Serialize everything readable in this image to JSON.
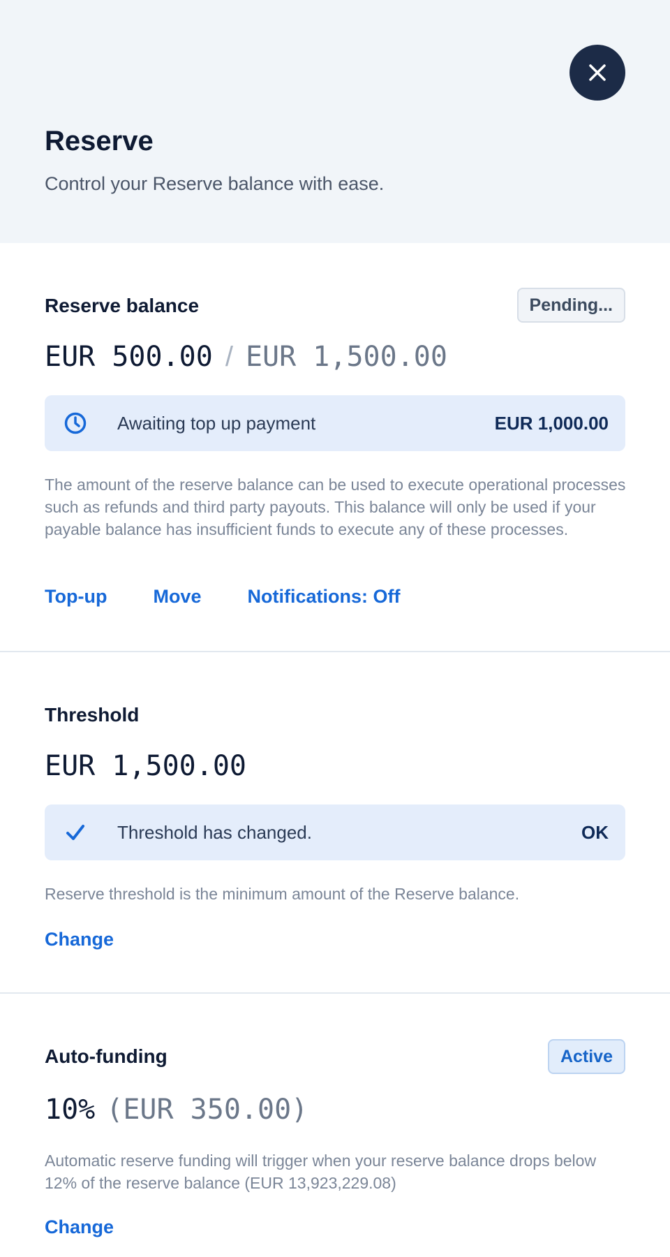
{
  "header": {
    "title": "Reserve",
    "subtitle": "Control your Reserve balance with ease.",
    "close_icon": "close-icon"
  },
  "reserve_balance": {
    "title": "Reserve balance",
    "status_badge": "Pending...",
    "current_amount": "EUR 500.00",
    "separator": "/",
    "target_amount": "EUR 1,500.00",
    "callout": {
      "icon": "clock-icon",
      "text": "Awaiting top up payment",
      "amount": "EUR 1,000.00"
    },
    "description": "The amount of the reserve balance can be used to execute operational processes such as refunds and third party payouts. This balance will only be used if your payable balance has insufficient funds to execute any of these processes.",
    "actions": {
      "topup": "Top-up",
      "move": "Move",
      "notifications": "Notifications: Off"
    }
  },
  "threshold": {
    "title": "Threshold",
    "amount": "EUR 1,500.00",
    "callout": {
      "icon": "checkmark-icon",
      "text": "Threshold has changed.",
      "action": "OK"
    },
    "description": "Reserve threshold is the minimum amount of the Reserve balance.",
    "change_label": "Change"
  },
  "auto_funding": {
    "title": "Auto-funding",
    "status_badge": "Active",
    "percent": "10%",
    "amount": "(EUR 350.00)",
    "description": "Automatic reserve funding will trigger when your reserve balance drops below 12% of the reserve balance (EUR 13,923,229.08)",
    "change_label": "Change"
  },
  "colors": {
    "accent": "#1668d8",
    "header_bg": "#f1f5f9",
    "callout_bg": "#e4edfb",
    "close_bg": "#1c2b47"
  }
}
